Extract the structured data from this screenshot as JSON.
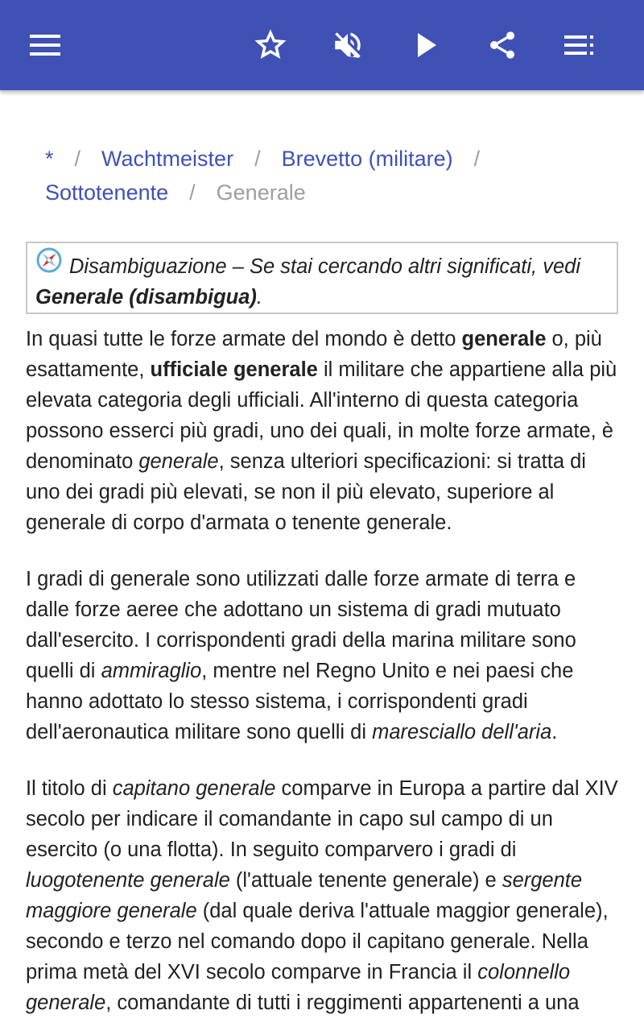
{
  "appbar": {
    "color": "#3F51B5",
    "icons": [
      "menu-icon",
      "star-outline-icon",
      "volume-off-icon",
      "play-icon",
      "share-icon",
      "toc-list-icon"
    ]
  },
  "breadcrumb": {
    "items": [
      "*",
      "Wachtmeister",
      "Brevetto (militare)",
      "Sottotenente"
    ],
    "separator": "/",
    "current": "Generale"
  },
  "hatnote": {
    "prefix": "Disambiguazione – Se stai cercando altri significati, vedi",
    "link": "Generale (disambigua)",
    "suffix": "."
  },
  "article": {
    "p1": {
      "a": "In quasi tutte le forze armate del mondo è detto ",
      "b1": "generale",
      "c": " o, più esattamente, ",
      "b2": "ufficiale generale",
      "d": " il militare che appartiene alla più elevata categoria degli ufficiali. All'interno di questa categoria possono esserci più gradi, uno dei quali, in molte forze armate, è denominato ",
      "i1": "generale",
      "e": ", senza ulteriori specificazioni: si tratta di uno dei gradi più elevati, se non il più elevato, superiore al generale di corpo d'armata o tenente generale."
    },
    "p2": {
      "a": "I gradi di generale sono utilizzati dalle forze armate di terra e dalle forze aeree che adottano un sistema di gradi mutuato dall'esercito. I corrispondenti gradi della marina militare sono quelli di ",
      "i1": "ammiraglio",
      "b": ", mentre nel Regno Unito e nei paesi che hanno adottato lo stesso sistema, i corrispondenti gradi dell'aeronautica militare sono quelli di ",
      "i2": "maresciallo dell'aria",
      "c": "."
    },
    "p3": {
      "a": "Il titolo di ",
      "i1": "capitano generale",
      "b": " comparve in Europa a partire dal XIV secolo per indicare il comandante in capo sul campo di un esercito (o una flotta). In seguito comparvero i gradi di ",
      "i2": "luogotenente generale",
      "c": " (l'attuale tenente generale) e ",
      "i3": "sergente maggiore generale",
      "d": " (dal quale deriva l'attuale maggior generale), secondo e terzo nel comando dopo il capitano generale. Nella prima metà del XVI secolo comparve in Francia il ",
      "i4": "colonnello generale",
      "e": ", comandante di tutti i reggimenti appartenenti a una"
    }
  }
}
